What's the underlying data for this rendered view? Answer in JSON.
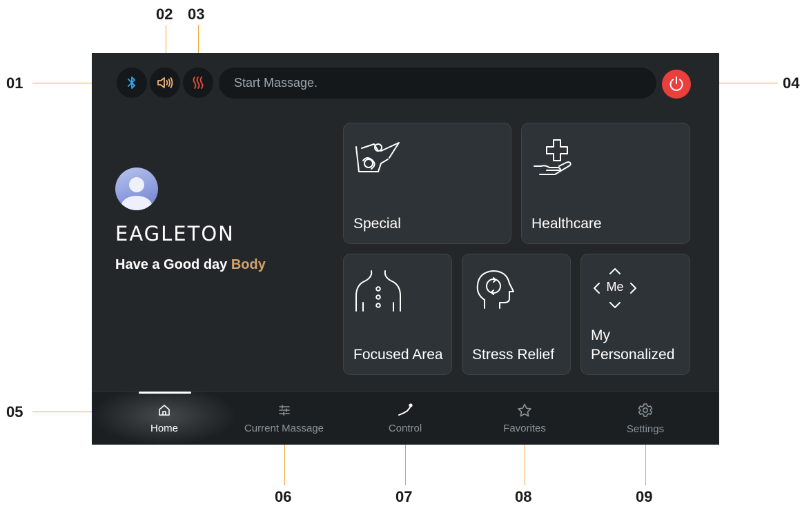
{
  "callouts": {
    "c01": "01",
    "c02": "02",
    "c03": "03",
    "c04": "04",
    "c05": "05",
    "c06": "06",
    "c07": "07",
    "c08": "08",
    "c09": "09"
  },
  "status": {
    "bluetooth_icon": "bluetooth-icon",
    "sound_icon": "speaker-icon",
    "heat_icon": "heat-icon",
    "message": "Start Massage.",
    "power_icon": "power-icon",
    "power_color": "#ea3f3c"
  },
  "profile": {
    "name": "EAGLETON",
    "greeting_prefix": "Have a Good day ",
    "greeting_highlight": "Body",
    "highlight_color": "#d4a36a"
  },
  "cards": {
    "special": "Special",
    "healthcare": "Healthcare",
    "focused_area": "Focused Area",
    "stress_relief": "Stress Relief",
    "my_personalized_line1": "My",
    "my_personalized_line2": "Personalized",
    "me_icon_text": "Me"
  },
  "nav": {
    "home": "Home",
    "current_massage": "Current Massage",
    "control": "Control",
    "favorites": "Favorites",
    "settings": "Settings",
    "active": "Home"
  },
  "colors": {
    "accent_callout": "#f0a23a",
    "screen_bg": "#23272a",
    "card_bg": "#2e3337",
    "bluetooth": "#2fa8f4",
    "sound": "#f0b27a",
    "heat": "#e8503a"
  }
}
